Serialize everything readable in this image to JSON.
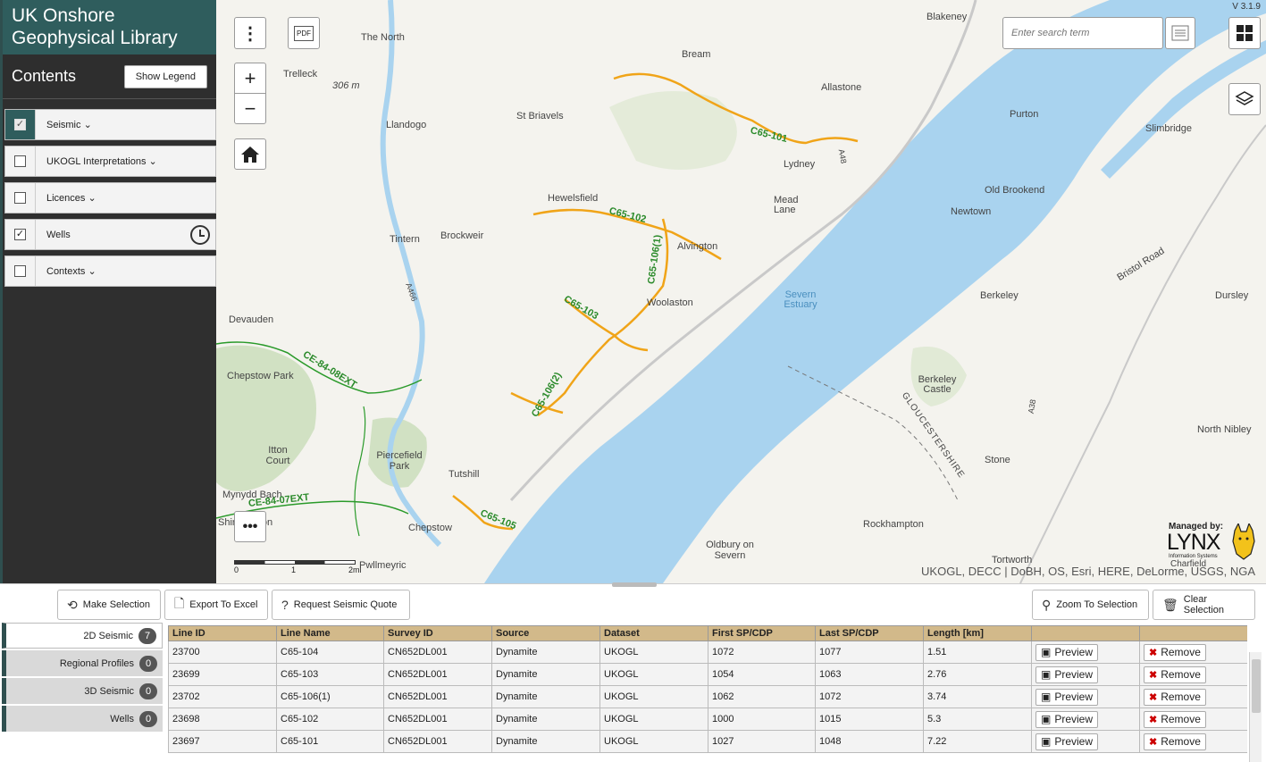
{
  "app": {
    "title_line1": "UK Onshore",
    "title_line2": "Geophysical Library",
    "version": "V 3.1.9"
  },
  "sidebar": {
    "contents_title": "Contents",
    "legend_button": "Show Legend",
    "layers": [
      {
        "label": "Seismic",
        "checked": true
      },
      {
        "label": "UKOGL Interpretations",
        "checked": false
      },
      {
        "label": "Licences",
        "checked": false
      },
      {
        "label": "Wells",
        "checked": true
      },
      {
        "label": "Contexts",
        "checked": false
      }
    ]
  },
  "map": {
    "search_placeholder": "Enter search term",
    "pdf_label": "PDF",
    "attribution": "UKOGL, DECC | DoBH, OS, Esri, HERE, DeLorme, USGS, NGA",
    "lynx": {
      "managed_by": "Managed by:",
      "name": "LYNX",
      "sub": "Information Systems"
    },
    "scale": {
      "t0": "0",
      "t1": "1",
      "t2": "2mi"
    },
    "places": [
      "The North",
      "Trelleck",
      "306 m",
      "Llandogo",
      "Bream",
      "Blakeney",
      "Allastone",
      "Purton",
      "Slimbridge",
      "St Briavels",
      "Lydney",
      "Mead Lane",
      "Hewelsfield",
      "Old Brookend",
      "Newtown",
      "Tintern",
      "Brockweir",
      "Alvington",
      "Bristol Road",
      "Woolaston",
      "Severn Estuary",
      "Berkeley",
      "Dursley",
      "Devauden",
      "Chepstow Park",
      "Berkeley Castle",
      "GLOUCESTERSHIRE",
      "Itton Court",
      "Piercefield Park",
      "North Nibley",
      "Tutshill",
      "Stone",
      "Mynydd Bach",
      "Shirenewton",
      "Chepstow",
      "Rockhampton",
      "Oldbury on Severn",
      "Tortworth",
      "Pwllmeyric",
      "A466",
      "A48",
      "A38",
      "Charfield"
    ],
    "seismic_lines": [
      "C65-101",
      "C65-102",
      "C65-103",
      "C65-106(1)",
      "C65-106(2)",
      "C65-105",
      "CE-84-08EXT",
      "CE-84-07EXT"
    ]
  },
  "toolbar": {
    "make_selection": "Make Selection",
    "export_excel": "Export To Excel",
    "request_quote": "Request Seismic Quote",
    "zoom_selection": "Zoom To Selection",
    "clear_selection": "Clear Selection"
  },
  "tabs": [
    {
      "label": "2D Seismic",
      "count": "7"
    },
    {
      "label": "Regional Profiles",
      "count": "0"
    },
    {
      "label": "3D Seismic",
      "count": "0"
    },
    {
      "label": "Wells",
      "count": "0"
    }
  ],
  "table": {
    "columns": [
      "Line ID",
      "Line Name",
      "Survey ID",
      "Source",
      "Dataset",
      "First SP/CDP",
      "Last SP/CDP",
      "Length [km]",
      "",
      ""
    ],
    "preview_label": "Preview",
    "remove_label": "Remove",
    "rows": [
      [
        "23700",
        "C65-104",
        "CN652DL001",
        "Dynamite",
        "UKOGL",
        "1072",
        "1077",
        "1.51"
      ],
      [
        "23699",
        "C65-103",
        "CN652DL001",
        "Dynamite",
        "UKOGL",
        "1054",
        "1063",
        "2.76"
      ],
      [
        "23702",
        "C65-106(1)",
        "CN652DL001",
        "Dynamite",
        "UKOGL",
        "1062",
        "1072",
        "3.74"
      ],
      [
        "23698",
        "C65-102",
        "CN652DL001",
        "Dynamite",
        "UKOGL",
        "1000",
        "1015",
        "5.3"
      ],
      [
        "23697",
        "C65-101",
        "CN652DL001",
        "Dynamite",
        "UKOGL",
        "1027",
        "1048",
        "7.22"
      ]
    ]
  }
}
